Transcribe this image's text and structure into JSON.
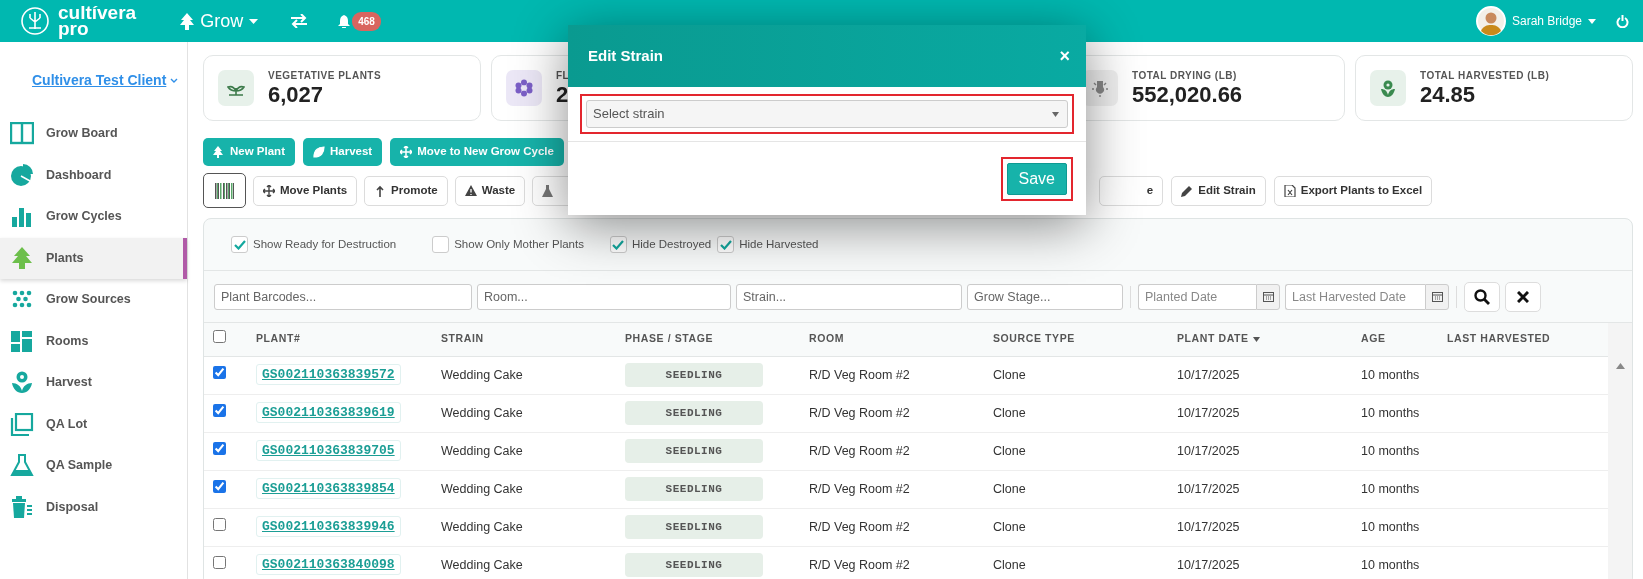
{
  "brand": {
    "name": "cultívera",
    "tagline": "pro"
  },
  "topbar": {
    "module": "Grow",
    "notifications": "468",
    "user": "Sarah Bridge"
  },
  "sidebar": {
    "client": "Cultivera Test Client",
    "items": [
      {
        "label": "Grow Board",
        "selected": false
      },
      {
        "label": "Dashboard",
        "selected": false
      },
      {
        "label": "Grow Cycles",
        "selected": false
      },
      {
        "label": "Plants",
        "selected": true
      },
      {
        "label": "Grow Sources",
        "selected": false
      },
      {
        "label": "Rooms",
        "selected": false
      },
      {
        "label": "Harvest",
        "selected": false
      },
      {
        "label": "QA Lot",
        "selected": false
      },
      {
        "label": "QA Sample",
        "selected": false
      },
      {
        "label": "Disposal",
        "selected": false
      }
    ]
  },
  "stats": [
    {
      "label": "VEGETATIVE PLANTS",
      "value": "6,027"
    },
    {
      "label": "FL",
      "value": "2"
    },
    {
      "label": "TOTAL DRYING (LB)",
      "value": "552,020.66"
    },
    {
      "label": "TOTAL HARVESTED (LB)",
      "value": "24.85"
    }
  ],
  "actions": [
    "New Plant",
    "Harvest",
    "Move to New Grow Cycle"
  ],
  "tools": {
    "left": [
      "Move Plants",
      "Promote",
      "Waste"
    ],
    "right": [
      "e",
      "Edit Strain",
      "Export Plants to Excel"
    ]
  },
  "filters": {
    "checkboxes": [
      {
        "label": "Show Ready for Destruction",
        "checked": true
      },
      {
        "label": "Show Only Mother Plants",
        "checked": false
      },
      {
        "label": "Hide Destroyed",
        "checked": true
      },
      {
        "label": "Hide Harvested",
        "checked": true
      }
    ],
    "fields": [
      {
        "placeholder": "Plant Barcodes...",
        "kind": "text"
      },
      {
        "placeholder": "Room...",
        "kind": "text"
      },
      {
        "placeholder": "Strain...",
        "kind": "text"
      },
      {
        "placeholder": "Grow Stage...",
        "kind": "text"
      },
      {
        "placeholder": "Planted Date",
        "kind": "date"
      },
      {
        "placeholder": "Last Harvested Date",
        "kind": "date"
      }
    ]
  },
  "table": {
    "select_all": {
      "checked": false
    },
    "columns": [
      {
        "label": "PLANT#",
        "sorted": false
      },
      {
        "label": "STRAIN",
        "sorted": false
      },
      {
        "label": "PHASE / STAGE",
        "sorted": false
      },
      {
        "label": "ROOM",
        "sorted": false
      },
      {
        "label": "SOURCE TYPE",
        "sorted": false
      },
      {
        "label": "PLANT DATE",
        "sorted": true
      },
      {
        "label": "AGE",
        "sorted": false
      },
      {
        "label": "LAST HARVESTED",
        "sorted": false
      }
    ],
    "rows": [
      {
        "checked": true,
        "plant": "GS002110363839572",
        "strain": "Wedding Cake",
        "stage": "SEEDLING",
        "room": "R/D Veg Room #2",
        "source": "Clone",
        "date": "10/17/2025",
        "age": "10 months"
      },
      {
        "checked": true,
        "plant": "GS002110363839619",
        "strain": "Wedding Cake",
        "stage": "SEEDLING",
        "room": "R/D Veg Room #2",
        "source": "Clone",
        "date": "10/17/2025",
        "age": "10 months"
      },
      {
        "checked": true,
        "plant": "GS002110363839705",
        "strain": "Wedding Cake",
        "stage": "SEEDLING",
        "room": "R/D Veg Room #2",
        "source": "Clone",
        "date": "10/17/2025",
        "age": "10 months"
      },
      {
        "checked": true,
        "plant": "GS002110363839854",
        "strain": "Wedding Cake",
        "stage": "SEEDLING",
        "room": "R/D Veg Room #2",
        "source": "Clone",
        "date": "10/17/2025",
        "age": "10 months"
      },
      {
        "checked": false,
        "plant": "GS002110363839946",
        "strain": "Wedding Cake",
        "stage": "SEEDLING",
        "room": "R/D Veg Room #2",
        "source": "Clone",
        "date": "10/17/2025",
        "age": "10 months"
      },
      {
        "checked": false,
        "plant": "GS002110363840098",
        "strain": "Wedding Cake",
        "stage": "SEEDLING",
        "room": "R/D Veg Room #2",
        "source": "Clone",
        "date": "10/17/2025",
        "age": "10 months"
      }
    ]
  },
  "dialog": {
    "title": "Edit Strain",
    "close": "×",
    "select": {
      "placeholder": "Select strain"
    },
    "save": "Save"
  }
}
